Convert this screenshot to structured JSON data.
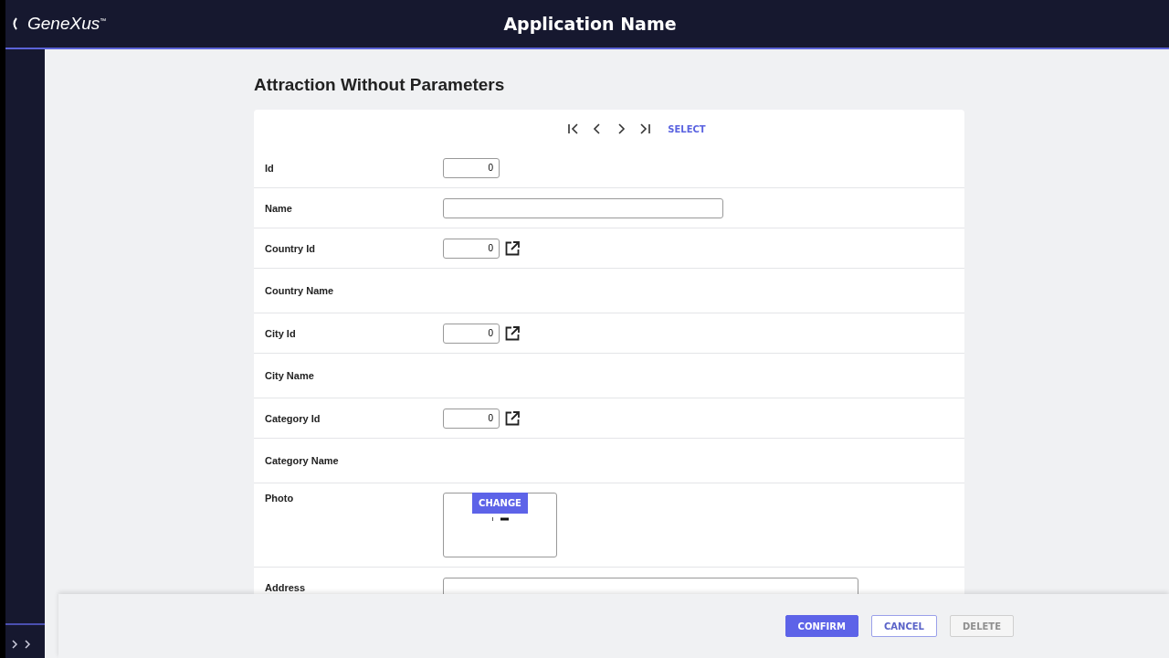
{
  "header": {
    "logo": "GeneXus$^{™}$",
    "title": "Application Name"
  },
  "page_title": "Attraction Without Parameters",
  "navigation": {
    "select_link": "SELECT"
  },
  "fields": [
    {
      "label": "Id",
      "kind": "number",
      "value": "0"
    },
    {
      "label": "Name",
      "kind": "text"
    },
    {
      "label": "Country Id",
      "kind": "number_prompt",
      "value": "0"
    },
    {
      "label": "Country Name",
      "kind": "readonly"
    },
    {
      "label": "City Id",
      "kind": "number_prompt",
      "value": "0"
    },
    {
      "label": "City Name",
      "kind": "readonly"
    },
    {
      "label": "Category Id",
      "kind": "number_prompt",
      "value": "0"
    },
    {
      "label": "Category Name",
      "kind": "readonly"
    },
    {
      "label": "Photo",
      "kind": "image",
      "button": "CHANGE"
    },
    {
      "label": "Address",
      "kind": "wide_text"
    }
  ],
  "actions": [
    {
      "label": "CONFIRM",
      "kind": "primary",
      "disabled": false
    },
    {
      "label": "CANCEL",
      "kind": "secondary",
      "disabled": false
    },
    {
      "label": "DELETE",
      "kind": "secondary",
      "disabled": true
    }
  ]
}
